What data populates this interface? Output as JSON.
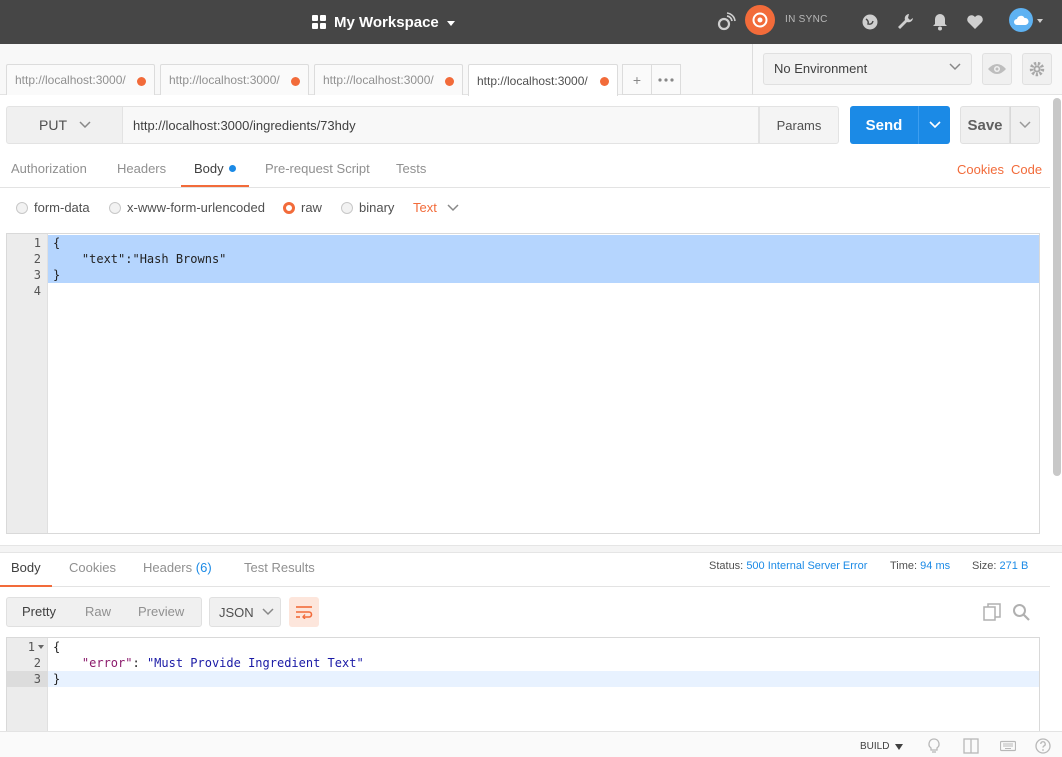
{
  "header": {
    "workspace_label": "My Workspace",
    "sync_status": "IN SYNC",
    "colors": {
      "bar": "#464646",
      "accent": "#f26b3a",
      "sync": "#f26b3a"
    }
  },
  "tabs": [
    {
      "label": "http://localhost:3000/",
      "active": false,
      "unsaved": true
    },
    {
      "label": "http://localhost:3000/",
      "active": false,
      "unsaved": true
    },
    {
      "label": "http://localhost:3000/",
      "active": false,
      "unsaved": true
    },
    {
      "label": "http://localhost:3000/",
      "active": true,
      "unsaved": true
    }
  ],
  "environment": {
    "selected": "No Environment"
  },
  "request": {
    "method": "PUT",
    "url": "http://localhost:3000/ingredients/73hdy",
    "params_label": "Params",
    "send_label": "Send",
    "save_label": "Save"
  },
  "request_tabs": {
    "authorization": "Authorization",
    "headers": "Headers",
    "body": "Body",
    "prerequest": "Pre-request Script",
    "tests": "Tests",
    "cookies_link": "Cookies",
    "code_link": "Code"
  },
  "body_types": {
    "form_data": "form-data",
    "urlencoded": "x-www-form-urlencoded",
    "raw": "raw",
    "binary": "binary",
    "selected": "raw",
    "raw_format": "Text"
  },
  "request_body": {
    "lines": [
      {
        "num": "1",
        "text": "{"
      },
      {
        "num": "2",
        "text": "    \"text\":\"Hash Browns\""
      },
      {
        "num": "3",
        "text": "}"
      },
      {
        "num": "4",
        "text": ""
      }
    ]
  },
  "response_tabs": {
    "body": "Body",
    "cookies": "Cookies",
    "headers": "Headers",
    "headers_count": "(6)",
    "test_results": "Test Results"
  },
  "response_meta": {
    "status_label": "Status:",
    "status_value": "500 Internal Server Error",
    "time_label": "Time:",
    "time_value": "94 ms",
    "size_label": "Size:",
    "size_value": "271 B"
  },
  "response_format": {
    "pretty": "Pretty",
    "raw": "Raw",
    "preview": "Preview",
    "language": "JSON"
  },
  "response_body": {
    "line1_num": "1",
    "line1": "{",
    "line2_num": "2",
    "line2_key": "\"error\"",
    "line2_sep": ": ",
    "line2_value": "\"Must Provide Ingredient Text\"",
    "line3_num": "3",
    "line3": "}"
  },
  "footer": {
    "build_label": "BUILD"
  }
}
